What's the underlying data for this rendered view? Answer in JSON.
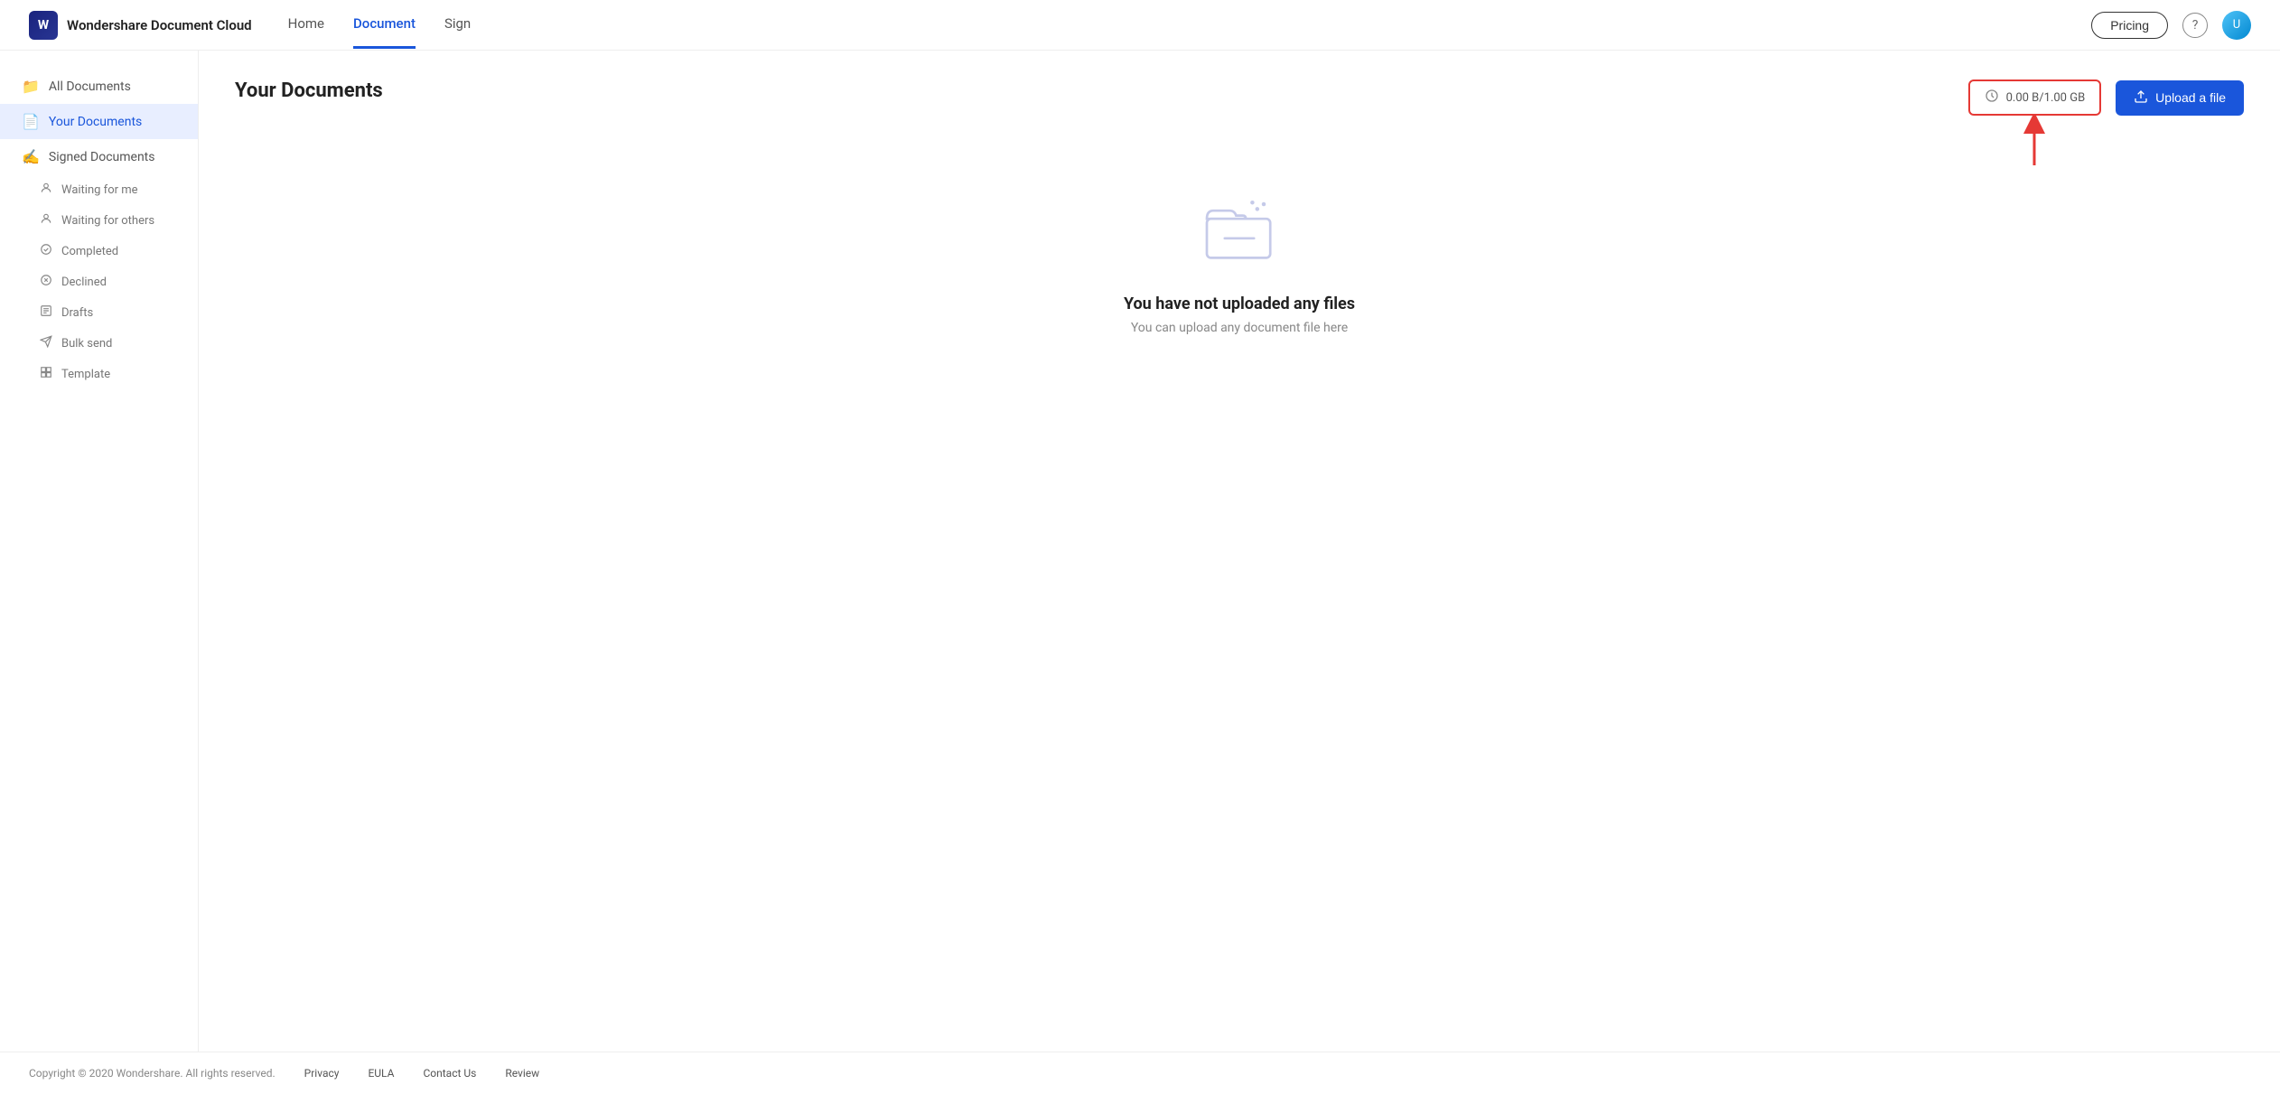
{
  "header": {
    "logo_text": "Wondershare Document Cloud",
    "nav": [
      {
        "label": "Home",
        "active": false
      },
      {
        "label": "Document",
        "active": true
      },
      {
        "label": "Sign",
        "active": false
      }
    ],
    "pricing_label": "Pricing",
    "help_icon": "?",
    "avatar_initials": "U"
  },
  "sidebar": {
    "all_documents_label": "All Documents",
    "your_documents_label": "Your Documents",
    "signed_documents_label": "Signed Documents",
    "sub_items": [
      {
        "label": "Waiting for me",
        "icon": "person"
      },
      {
        "label": "Waiting for others",
        "icon": "person"
      },
      {
        "label": "Completed",
        "icon": "check"
      },
      {
        "label": "Declined",
        "icon": "decline"
      },
      {
        "label": "Drafts",
        "icon": "draft"
      },
      {
        "label": "Bulk send",
        "icon": "send"
      },
      {
        "label": "Template",
        "icon": "template"
      }
    ]
  },
  "main": {
    "page_title": "Your Documents",
    "storage_text": "0.00 B/1.00 GB",
    "upload_label": "Upload a file",
    "empty_title": "You have not uploaded any files",
    "empty_sub": "You can upload any document file here"
  },
  "footer": {
    "copyright": "Copyright © 2020 Wondershare. All rights reserved.",
    "links": [
      "Privacy",
      "EULA",
      "Contact Us",
      "Review"
    ]
  }
}
